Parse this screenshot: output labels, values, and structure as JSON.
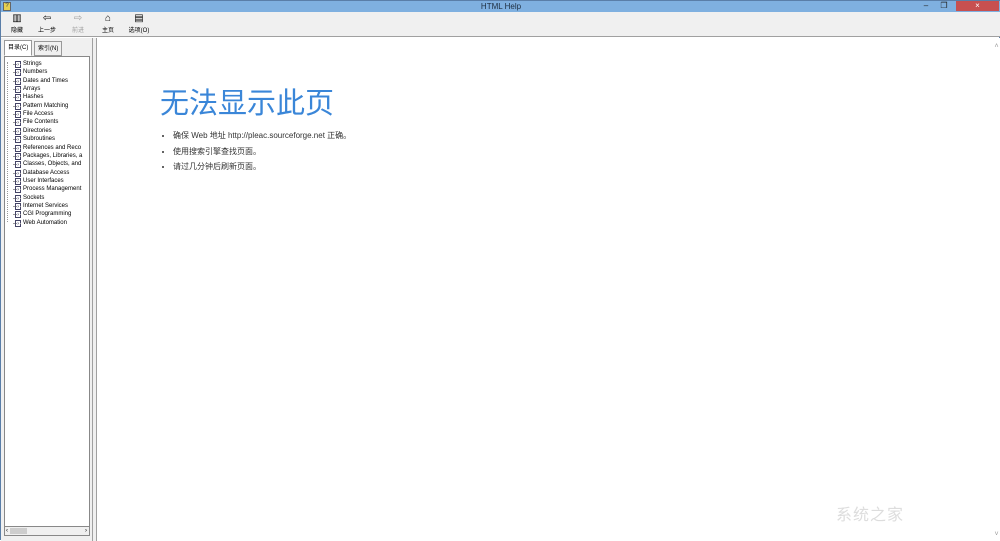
{
  "window": {
    "title": "HTML Help",
    "minimize": "–",
    "restore": "❐",
    "close": "×"
  },
  "toolbar": {
    "hide": "隐藏",
    "back": "上一步",
    "forward": "前进",
    "home": "主页",
    "options": "选项(O)"
  },
  "tabs": [
    {
      "label": "目录(C)",
      "active": true
    },
    {
      "label": "索引(N)",
      "active": false
    }
  ],
  "tree": {
    "items": [
      "Strings",
      "Numbers",
      "Dates and Times",
      "Arrays",
      "Hashes",
      "Pattern Matching",
      "File Access",
      "File Contents",
      "Directories",
      "Subroutines",
      "References and Reco",
      "Packages, Libraries, a",
      "Classes, Objects, and",
      "Database Access",
      "User Interfaces",
      "Process Management",
      "Sockets",
      "Internet Services",
      "CGI Programming",
      "Web Automation"
    ]
  },
  "content": {
    "heading": "无法显示此页",
    "bullets": [
      "确保 Web 地址 http://pleac.sourceforge.net 正确。",
      "使用搜索引擎查找页面。",
      "请过几分钟后刷新页面。"
    ],
    "heading_color": "#3a86d8"
  },
  "watermark": "系统之家"
}
